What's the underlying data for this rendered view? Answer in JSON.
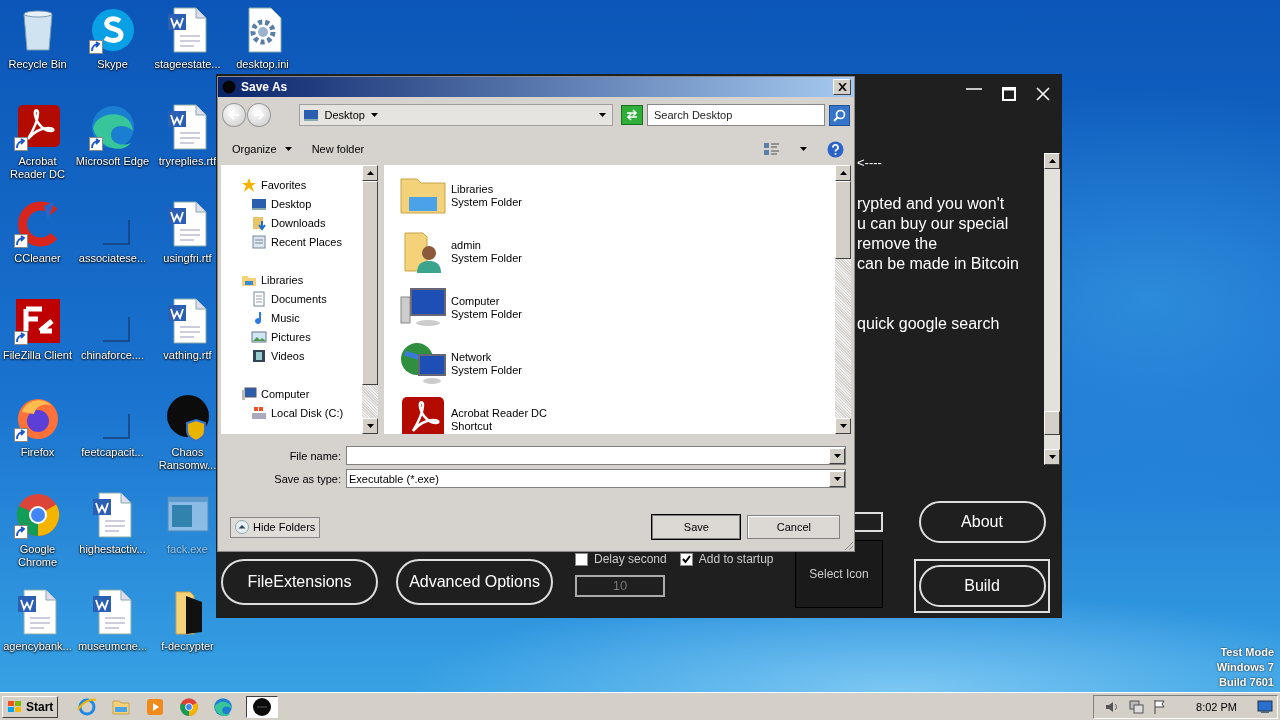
{
  "desktop_icons": [
    {
      "label": "Recycle Bin",
      "kind": "recycle",
      "shortcut": false,
      "hidden": false
    },
    {
      "label": "Acrobat Reader DC",
      "kind": "acrobat",
      "shortcut": true,
      "hidden": false
    },
    {
      "label": "CCleaner",
      "kind": "ccleaner",
      "shortcut": true,
      "hidden": false
    },
    {
      "label": "FileZilla Client",
      "kind": "filezilla",
      "shortcut": true,
      "hidden": false
    },
    {
      "label": "Firefox",
      "kind": "firefox",
      "shortcut": true,
      "hidden": false
    },
    {
      "label": "Google Chrome",
      "kind": "chrome",
      "shortcut": true,
      "hidden": false
    },
    {
      "label": "agencybank...",
      "kind": "document",
      "shortcut": false,
      "hidden": false
    },
    {
      "label": "Skype",
      "kind": "skype",
      "shortcut": true,
      "hidden": false
    },
    {
      "label": "Microsoft Edge",
      "kind": "edge",
      "shortcut": true,
      "hidden": false
    },
    {
      "label": "associatese...",
      "kind": "blank",
      "shortcut": false,
      "hidden": false
    },
    {
      "label": "chinaforce....",
      "kind": "blank",
      "shortcut": false,
      "hidden": false
    },
    {
      "label": "feetcapacit...",
      "kind": "blank",
      "shortcut": false,
      "hidden": false
    },
    {
      "label": "highestactiv...",
      "kind": "document",
      "shortcut": false,
      "hidden": false
    },
    {
      "label": "museumcne...",
      "kind": "document",
      "shortcut": false,
      "hidden": false
    },
    {
      "label": "stageestate...",
      "kind": "document",
      "shortcut": false,
      "hidden": false
    },
    {
      "label": "tryreplies.rtf",
      "kind": "document",
      "shortcut": false,
      "hidden": false
    },
    {
      "label": "usingfri.rtf",
      "kind": "document",
      "shortcut": false,
      "hidden": false
    },
    {
      "label": "vathing.rtf",
      "kind": "document",
      "shortcut": false,
      "hidden": false
    },
    {
      "label": "Chaos Ransomw...",
      "kind": "chaos",
      "shortcut": false,
      "hidden": false
    },
    {
      "label": "fack.exe",
      "kind": "program",
      "shortcut": false,
      "hidden": true
    },
    {
      "label": "f-decrypter",
      "kind": "folder",
      "shortcut": false,
      "hidden": false
    },
    {
      "label": "desktop.ini",
      "kind": "settings-file",
      "shortcut": false,
      "hidden": false
    }
  ],
  "builder": {
    "message": [
      [
        "<----"
      ],
      [
        "rypted and you won't",
        "u can buy our special",
        "remove the",
        "can be made in Bitcoin"
      ],
      [
        "quick google search"
      ]
    ],
    "buttons": [
      {
        "label": "About",
        "focused": false
      },
      {
        "label": "Build",
        "focused": true
      }
    ],
    "file_extensions_button": "FileExtensions",
    "advanced_options_button": "Advanced Options",
    "delay": {
      "label": "Delay second",
      "checked": false,
      "value": "10",
      "disabled": true
    },
    "startup": {
      "label": "Add to startup",
      "checked": true
    },
    "select_icon": "Select Icon"
  },
  "save_dialog": {
    "title": "Save As",
    "location": "Desktop",
    "search_placeholder": "Search Desktop",
    "toolbar": [
      {
        "label": "Organize",
        "dropdown": true
      },
      {
        "label": "New folder",
        "dropdown": false
      }
    ],
    "nav": [
      {
        "label": "Favorites",
        "kind": "star",
        "children": [
          {
            "label": "Desktop",
            "kind": "desktop"
          },
          {
            "label": "Downloads",
            "kind": "downloads"
          },
          {
            "label": "Recent Places",
            "kind": "recent"
          }
        ]
      },
      {
        "label": "Libraries",
        "kind": "libraries",
        "children": [
          {
            "label": "Documents",
            "kind": "documents"
          },
          {
            "label": "Music",
            "kind": "music"
          },
          {
            "label": "Pictures",
            "kind": "pictures"
          },
          {
            "label": "Videos",
            "kind": "videos"
          }
        ]
      },
      {
        "label": "Computer",
        "kind": "computer",
        "children": [
          {
            "label": "Local Disk (C:)",
            "kind": "disk"
          }
        ]
      }
    ],
    "items": [
      {
        "name": "Libraries",
        "type": "System Folder",
        "kind": "libraries"
      },
      {
        "name": "admin",
        "type": "System Folder",
        "kind": "user"
      },
      {
        "name": "Computer",
        "type": "System Folder",
        "kind": "computer"
      },
      {
        "name": "Network",
        "type": "System Folder",
        "kind": "network"
      },
      {
        "name": "Acrobat Reader DC",
        "type": "Shortcut",
        "kind": "acrobat"
      }
    ],
    "file_name_label": "File name:",
    "save_type_label": "Save as type:",
    "save_type": "Executable (*.exe)",
    "hide_folders": "Hide Folders",
    "buttons": [
      {
        "label": "Save",
        "default": true
      },
      {
        "label": "Cancel",
        "default": false
      }
    ]
  },
  "taskbar": {
    "start": "Start",
    "apps": [
      {
        "kind": "ie",
        "active": false
      },
      {
        "kind": "explorer",
        "active": false
      },
      {
        "kind": "media",
        "active": false
      },
      {
        "kind": "chrome",
        "active": false
      },
      {
        "kind": "edge",
        "active": false
      },
      {
        "kind": "chaos",
        "active": true
      }
    ],
    "clock": "8:02 PM"
  },
  "test_mode_notice": [
    "Test Mode",
    "Windows 7",
    "Build 7601"
  ]
}
